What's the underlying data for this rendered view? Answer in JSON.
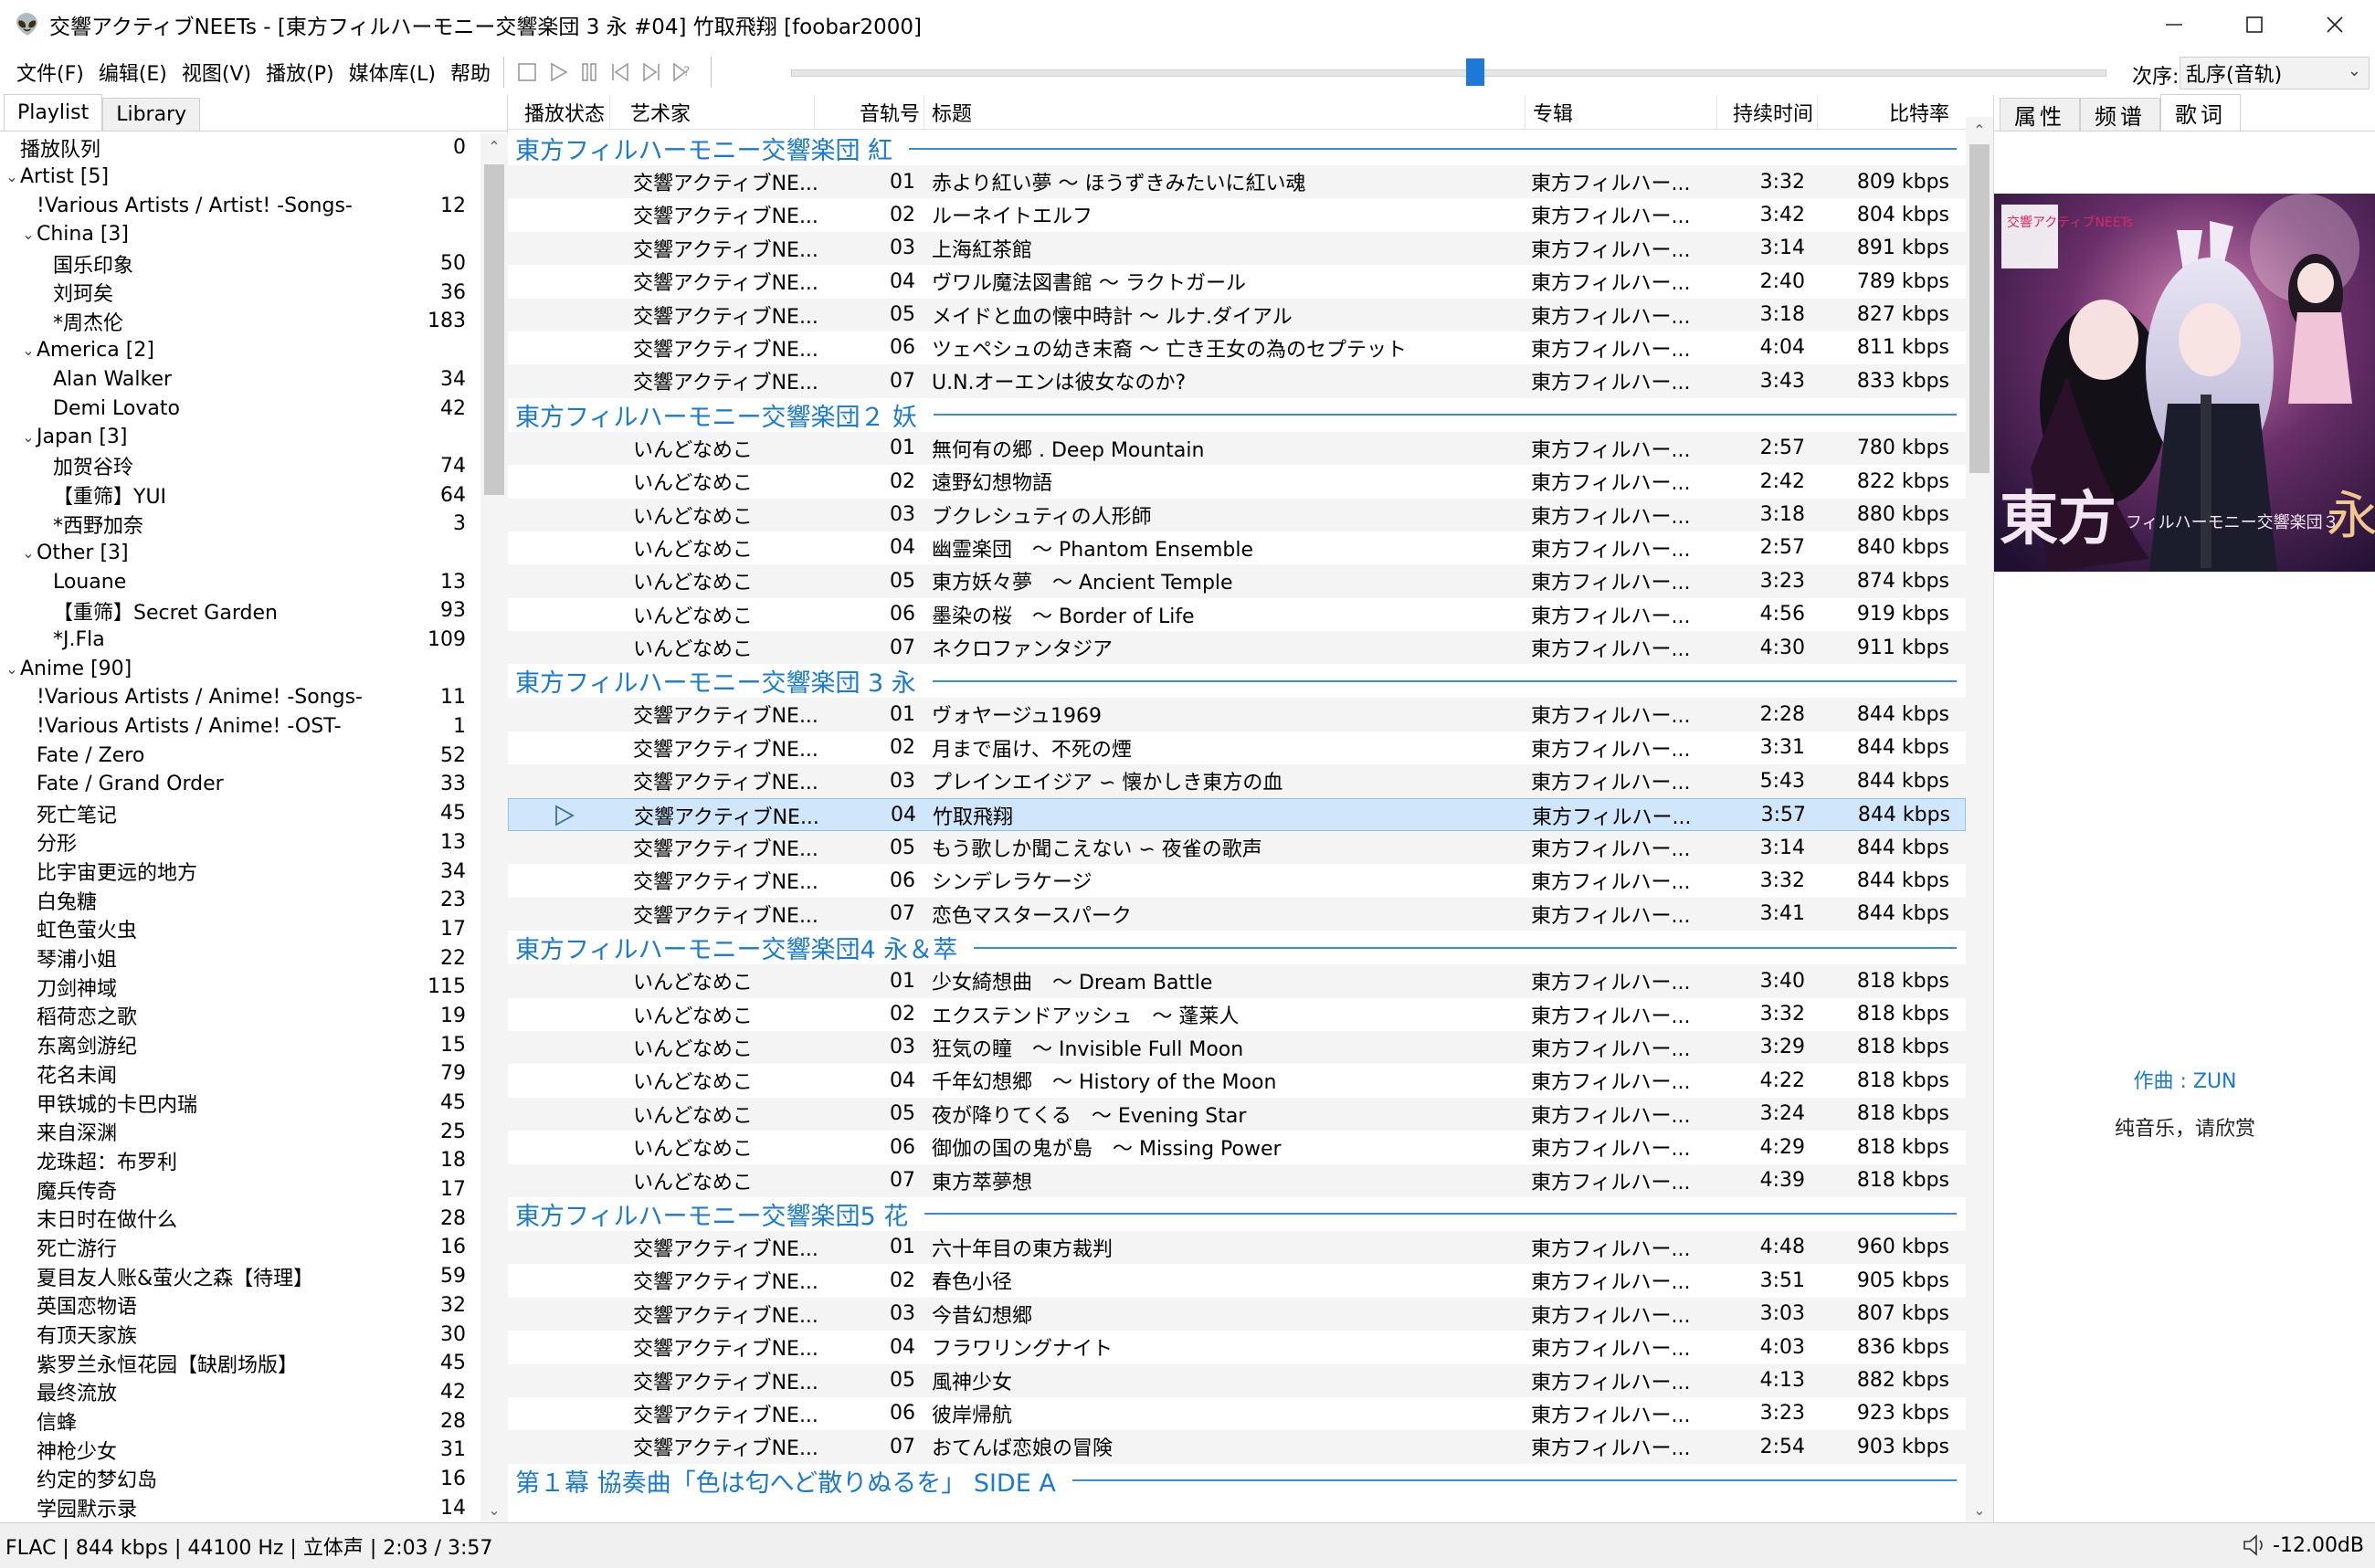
{
  "window": {
    "title": "交響アクティブNEETs - [東方フィルハーモニー交響楽団 3 永 #04] 竹取飛翔  [foobar2000]",
    "icon": "alien-icon"
  },
  "menu": [
    "文件(F)",
    "编辑(E)",
    "视图(V)",
    "播放(P)",
    "媒体库(L)",
    "帮助"
  ],
  "playback_position_fraction": 0.52,
  "order": {
    "label": "次序:",
    "value": "乱序(音轨)"
  },
  "left_tabs": [
    "Playlist",
    "Library"
  ],
  "tree": [
    {
      "level": 0,
      "twisty": "",
      "label": "播放队列",
      "count": "0"
    },
    {
      "level": 0,
      "twisty": "v",
      "label": "Artist [5]",
      "count": ""
    },
    {
      "level": 1,
      "twisty": "",
      "label": "!Various Artists / Artist! -Songs-",
      "count": "12"
    },
    {
      "level": 1,
      "twisty": "v",
      "label": "China [3]",
      "count": ""
    },
    {
      "level": 2,
      "twisty": "",
      "label": "国乐印象",
      "count": "50"
    },
    {
      "level": 2,
      "twisty": "",
      "label": "刘珂矣",
      "count": "36"
    },
    {
      "level": 2,
      "twisty": "",
      "label": "*周杰伦",
      "count": "183"
    },
    {
      "level": 1,
      "twisty": "v",
      "label": "America [2]",
      "count": ""
    },
    {
      "level": 2,
      "twisty": "",
      "label": "Alan Walker",
      "count": "34"
    },
    {
      "level": 2,
      "twisty": "",
      "label": "Demi Lovato",
      "count": "42"
    },
    {
      "level": 1,
      "twisty": "v",
      "label": "Japan [3]",
      "count": ""
    },
    {
      "level": 2,
      "twisty": "",
      "label": "加贺谷玲",
      "count": "74"
    },
    {
      "level": 2,
      "twisty": "",
      "label": "【重筛】YUI",
      "count": "64"
    },
    {
      "level": 2,
      "twisty": "",
      "label": "*西野加奈",
      "count": "3"
    },
    {
      "level": 1,
      "twisty": "v",
      "label": "Other [3]",
      "count": ""
    },
    {
      "level": 2,
      "twisty": "",
      "label": "Louane",
      "count": "13"
    },
    {
      "level": 2,
      "twisty": "",
      "label": "【重筛】Secret Garden",
      "count": "93"
    },
    {
      "level": 2,
      "twisty": "",
      "label": "*J.Fla",
      "count": "109"
    },
    {
      "level": 0,
      "twisty": "v",
      "label": "Anime [90]",
      "count": ""
    },
    {
      "level": 1,
      "twisty": "",
      "label": "!Various Artists / Anime! -Songs-",
      "count": "11"
    },
    {
      "level": 1,
      "twisty": "",
      "label": "!Various Artists / Anime! -OST-",
      "count": "1"
    },
    {
      "level": 1,
      "twisty": "",
      "label": "Fate / Zero",
      "count": "52"
    },
    {
      "level": 1,
      "twisty": "",
      "label": "Fate / Grand Order",
      "count": "33"
    },
    {
      "level": 1,
      "twisty": "",
      "label": "死亡笔记",
      "count": "45"
    },
    {
      "level": 1,
      "twisty": "",
      "label": "分形",
      "count": "13"
    },
    {
      "level": 1,
      "twisty": "",
      "label": "比宇宙更远的地方",
      "count": "34"
    },
    {
      "level": 1,
      "twisty": "",
      "label": "白兔糖",
      "count": "23"
    },
    {
      "level": 1,
      "twisty": "",
      "label": "虹色萤火虫",
      "count": "17"
    },
    {
      "level": 1,
      "twisty": "",
      "label": "琴浦小姐",
      "count": "22"
    },
    {
      "level": 1,
      "twisty": "",
      "label": "刀剑神域",
      "count": "115"
    },
    {
      "level": 1,
      "twisty": "",
      "label": "稻荷恋之歌",
      "count": "19"
    },
    {
      "level": 1,
      "twisty": "",
      "label": "东离剑游纪",
      "count": "15"
    },
    {
      "level": 1,
      "twisty": "",
      "label": "花名未闻",
      "count": "79"
    },
    {
      "level": 1,
      "twisty": "",
      "label": "甲铁城的卡巴内瑞",
      "count": "45"
    },
    {
      "level": 1,
      "twisty": "",
      "label": "来自深渊",
      "count": "25"
    },
    {
      "level": 1,
      "twisty": "",
      "label": "龙珠超：布罗利",
      "count": "18"
    },
    {
      "level": 1,
      "twisty": "",
      "label": "魔兵传奇",
      "count": "17"
    },
    {
      "level": 1,
      "twisty": "",
      "label": "末日时在做什么",
      "count": "28"
    },
    {
      "level": 1,
      "twisty": "",
      "label": "死亡游行",
      "count": "16"
    },
    {
      "level": 1,
      "twisty": "",
      "label": "夏目友人账&萤火之森【待理】",
      "count": "59"
    },
    {
      "level": 1,
      "twisty": "",
      "label": "英国恋物语",
      "count": "32"
    },
    {
      "level": 1,
      "twisty": "",
      "label": "有顶天家族",
      "count": "30"
    },
    {
      "level": 1,
      "twisty": "",
      "label": "紫罗兰永恒花园【缺剧场版】",
      "count": "45"
    },
    {
      "level": 1,
      "twisty": "",
      "label": "最终流放",
      "count": "42"
    },
    {
      "level": 1,
      "twisty": "",
      "label": "信蜂",
      "count": "28"
    },
    {
      "level": 1,
      "twisty": "",
      "label": "神枪少女",
      "count": "31"
    },
    {
      "level": 1,
      "twisty": "",
      "label": "约定的梦幻岛",
      "count": "16"
    },
    {
      "level": 1,
      "twisty": "",
      "label": "学园默示录",
      "count": "14"
    }
  ],
  "columns": {
    "status": "播放状态",
    "artist": "艺术家",
    "tracknum": "音轨号",
    "title": "标题",
    "album": "专辑",
    "duration": "持续时间",
    "bitrate": "比特率"
  },
  "groups": [
    {
      "title": "東方フィルハーモニー交響楽団 紅",
      "tracks": [
        {
          "artist": "交響アクティブNE...",
          "num": "01",
          "title": "赤より紅い夢 ～ ほうずきみたいに紅い魂",
          "album": "東方フィルハー...",
          "dur": "3:32",
          "bitrate": "809 kbps"
        },
        {
          "artist": "交響アクティブNE...",
          "num": "02",
          "title": "ルーネイトエルフ",
          "album": "東方フィルハー...",
          "dur": "3:42",
          "bitrate": "804 kbps"
        },
        {
          "artist": "交響アクティブNE...",
          "num": "03",
          "title": "上海紅茶館",
          "album": "東方フィルハー...",
          "dur": "3:14",
          "bitrate": "891 kbps"
        },
        {
          "artist": "交響アクティブNE...",
          "num": "04",
          "title": "ヴワル魔法図書館 ～ ラクトガール",
          "album": "東方フィルハー...",
          "dur": "2:40",
          "bitrate": "789 kbps"
        },
        {
          "artist": "交響アクティブNE...",
          "num": "05",
          "title": "メイドと血の懐中時計 ～ ルナ.ダイアル",
          "album": "東方フィルハー...",
          "dur": "3:18",
          "bitrate": "827 kbps"
        },
        {
          "artist": "交響アクティブNE...",
          "num": "06",
          "title": "ツェペシュの幼き末裔 ～ 亡き王女の為のセプテット",
          "album": "東方フィルハー...",
          "dur": "4:04",
          "bitrate": "811 kbps"
        },
        {
          "artist": "交響アクティブNE...",
          "num": "07",
          "title": "U.N.オーエンは彼女なのか?",
          "album": "東方フィルハー...",
          "dur": "3:43",
          "bitrate": "833 kbps"
        }
      ]
    },
    {
      "title": "東方フィルハーモニー交響楽団２ 妖",
      "tracks": [
        {
          "artist": "いんどなめこ",
          "num": "01",
          "title": "無何有の郷 . Deep Mountain",
          "album": "東方フィルハー...",
          "dur": "2:57",
          "bitrate": "780 kbps"
        },
        {
          "artist": "いんどなめこ",
          "num": "02",
          "title": "遠野幻想物語",
          "album": "東方フィルハー...",
          "dur": "2:42",
          "bitrate": "822 kbps"
        },
        {
          "artist": "いんどなめこ",
          "num": "03",
          "title": "ブクレシュティの人形師",
          "album": "東方フィルハー...",
          "dur": "3:18",
          "bitrate": "880 kbps"
        },
        {
          "artist": "いんどなめこ",
          "num": "04",
          "title": "幽霊楽団　～ Phantom Ensemble",
          "album": "東方フィルハー...",
          "dur": "2:57",
          "bitrate": "840 kbps"
        },
        {
          "artist": "いんどなめこ",
          "num": "05",
          "title": "東方妖々夢　～ Ancient Temple",
          "album": "東方フィルハー...",
          "dur": "3:23",
          "bitrate": "874 kbps"
        },
        {
          "artist": "いんどなめこ",
          "num": "06",
          "title": "墨染の桜　～ Border of Life",
          "album": "東方フィルハー...",
          "dur": "4:56",
          "bitrate": "919 kbps"
        },
        {
          "artist": "いんどなめこ",
          "num": "07",
          "title": "ネクロファンタジア",
          "album": "東方フィルハー...",
          "dur": "4:30",
          "bitrate": "911 kbps"
        }
      ]
    },
    {
      "title": "東方フィルハーモニー交響楽団 3 永",
      "tracks": [
        {
          "artist": "交響アクティブNE...",
          "num": "01",
          "title": "ヴォヤージュ1969",
          "album": "東方フィルハー...",
          "dur": "2:28",
          "bitrate": "844 kbps"
        },
        {
          "artist": "交響アクティブNE...",
          "num": "02",
          "title": "月まで届け、不死の煙",
          "album": "東方フィルハー...",
          "dur": "3:31",
          "bitrate": "844 kbps"
        },
        {
          "artist": "交響アクティブNE...",
          "num": "03",
          "title": "プレインエイジア ∽ 懐かしき東方の血",
          "album": "東方フィルハー...",
          "dur": "5:43",
          "bitrate": "844 kbps"
        },
        {
          "artist": "交響アクティブNE...",
          "num": "04",
          "title": "竹取飛翔",
          "album": "東方フィルハー...",
          "dur": "3:57",
          "bitrate": "844 kbps",
          "playing": true
        },
        {
          "artist": "交響アクティブNE...",
          "num": "05",
          "title": "もう歌しか聞こえない ∽ 夜雀の歌声",
          "album": "東方フィルハー...",
          "dur": "3:14",
          "bitrate": "844 kbps"
        },
        {
          "artist": "交響アクティブNE...",
          "num": "06",
          "title": "シンデレラケージ",
          "album": "東方フィルハー...",
          "dur": "3:32",
          "bitrate": "844 kbps"
        },
        {
          "artist": "交響アクティブNE...",
          "num": "07",
          "title": "恋色マスタースパーク",
          "album": "東方フィルハー...",
          "dur": "3:41",
          "bitrate": "844 kbps"
        }
      ]
    },
    {
      "title": "東方フィルハーモニー交響楽団4 永＆萃",
      "tracks": [
        {
          "artist": "いんどなめこ",
          "num": "01",
          "title": "少女綺想曲　～ Dream Battle",
          "album": "東方フィルハー...",
          "dur": "3:40",
          "bitrate": "818 kbps"
        },
        {
          "artist": "いんどなめこ",
          "num": "02",
          "title": "エクステンドアッシュ　～ 蓬莱人",
          "album": "東方フィルハー...",
          "dur": "3:32",
          "bitrate": "818 kbps"
        },
        {
          "artist": "いんどなめこ",
          "num": "03",
          "title": "狂気の瞳　～ Invisible Full Moon",
          "album": "東方フィルハー...",
          "dur": "3:29",
          "bitrate": "818 kbps"
        },
        {
          "artist": "いんどなめこ",
          "num": "04",
          "title": "千年幻想郷　～ History of the Moon",
          "album": "東方フィルハー...",
          "dur": "4:22",
          "bitrate": "818 kbps"
        },
        {
          "artist": "いんどなめこ",
          "num": "05",
          "title": "夜が降りてくる　～ Evening Star",
          "album": "東方フィルハー...",
          "dur": "3:24",
          "bitrate": "818 kbps"
        },
        {
          "artist": "いんどなめこ",
          "num": "06",
          "title": "御伽の国の鬼が島　～ Missing Power",
          "album": "東方フィルハー...",
          "dur": "4:29",
          "bitrate": "818 kbps"
        },
        {
          "artist": "いんどなめこ",
          "num": "07",
          "title": "東方萃夢想",
          "album": "東方フィルハー...",
          "dur": "4:39",
          "bitrate": "818 kbps"
        }
      ]
    },
    {
      "title": "東方フィルハーモニー交響楽団5 花",
      "tracks": [
        {
          "artist": "交響アクティブNE...",
          "num": "01",
          "title": "六十年目の東方裁判",
          "album": "東方フィルハー...",
          "dur": "4:48",
          "bitrate": "960 kbps"
        },
        {
          "artist": "交響アクティブNE...",
          "num": "02",
          "title": "春色小径",
          "album": "東方フィルハー...",
          "dur": "3:51",
          "bitrate": "905 kbps"
        },
        {
          "artist": "交響アクティブNE...",
          "num": "03",
          "title": "今昔幻想郷",
          "album": "東方フィルハー...",
          "dur": "3:03",
          "bitrate": "807 kbps"
        },
        {
          "artist": "交響アクティブNE...",
          "num": "04",
          "title": "フラワリングナイト",
          "album": "東方フィルハー...",
          "dur": "4:03",
          "bitrate": "836 kbps"
        },
        {
          "artist": "交響アクティブNE...",
          "num": "05",
          "title": "風神少女",
          "album": "東方フィルハー...",
          "dur": "4:13",
          "bitrate": "882 kbps"
        },
        {
          "artist": "交響アクティブNE...",
          "num": "06",
          "title": "彼岸帰航",
          "album": "東方フィルハー...",
          "dur": "3:23",
          "bitrate": "923 kbps"
        },
        {
          "artist": "交響アクティブNE...",
          "num": "07",
          "title": "おてんば恋娘の冒険",
          "album": "東方フィルハー...",
          "dur": "2:54",
          "bitrate": "903 kbps"
        }
      ]
    },
    {
      "title": "第１幕 協奏曲「色は匂へど散りぬるを」 SIDE A",
      "tracks": []
    }
  ],
  "right_tabs": [
    "属性",
    "频谱",
    "歌词"
  ],
  "album_art": {
    "logo_text": "交響アクティブNEETs",
    "cover_title": "東方",
    "cover_subtitle": "フィルハーモニー交響楽団３",
    "cover_kanji": "永"
  },
  "lyrics": {
    "composer": "作曲 : ZUN",
    "line": "纯音乐，请欣赏"
  },
  "status": {
    "text": "FLAC | 844 kbps | 44100 Hz | 立体声 | 2:03 / 3:57",
    "volume": "-12.00dB"
  },
  "colors": {
    "accent": "#1a7ad0",
    "playing_row": "#cfe6fb",
    "seek_thumb": "#1e78d7"
  }
}
